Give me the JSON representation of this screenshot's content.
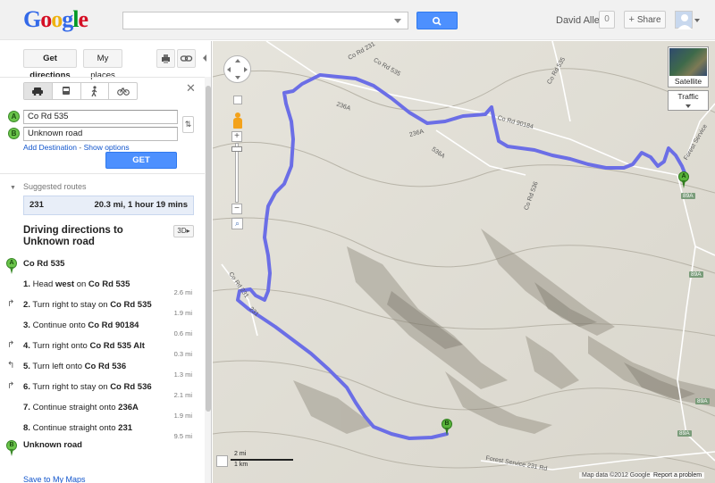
{
  "header": {
    "logo": [
      "G",
      "o",
      "o",
      "g",
      "l",
      "e"
    ],
    "user_name": "David Allen",
    "notification_count": "0",
    "share_label": "Share",
    "brand_blue": "#4d90fe"
  },
  "panel": {
    "get_directions_tab": "Get directions",
    "my_places_tab": "My places",
    "waypoint_a_letter": "A",
    "waypoint_b_letter": "B",
    "waypoint_a_value": "Co Rd 535",
    "waypoint_b_value": "Unknown road",
    "add_destination": "Add Destination",
    "show_options": "Show options",
    "get_directions_button": "GET DIRECTIONS",
    "suggested_routes_label": "Suggested routes",
    "route": {
      "name": "231",
      "summary": "20.3 mi, 1 hour 19 mins"
    },
    "directions_title": "Driving directions to Unknown road",
    "btn_3d": "3D",
    "start_name": "Co Rd 535",
    "end_name": "Unknown road",
    "steps": [
      {
        "num": "1.",
        "pre": "Head ",
        "bold1": "west",
        "mid": " on ",
        "road": "Co Rd 535",
        "dist": "2.6 mi"
      },
      {
        "num": "2.",
        "pre": "Turn right to stay on ",
        "bold1": "",
        "mid": "",
        "road": "Co Rd 535",
        "dist": "1.9 mi"
      },
      {
        "num": "3.",
        "pre": "Continue onto ",
        "bold1": "",
        "mid": "",
        "road": "Co Rd 90184",
        "dist": "0.6 mi"
      },
      {
        "num": "4.",
        "pre": "Turn right onto ",
        "bold1": "",
        "mid": "",
        "road": "Co Rd 535 Alt",
        "dist": "0.3 mi"
      },
      {
        "num": "5.",
        "pre": "Turn left onto ",
        "bold1": "",
        "mid": "",
        "road": "Co Rd 536",
        "dist": "1.3 mi"
      },
      {
        "num": "6.",
        "pre": "Turn right to stay on ",
        "bold1": "",
        "mid": "",
        "road": "Co Rd 536",
        "dist": "2.1 mi"
      },
      {
        "num": "7.",
        "pre": "Continue straight onto ",
        "bold1": "",
        "mid": "",
        "road": "236A",
        "dist": "1.9 mi"
      },
      {
        "num": "8.",
        "pre": "Continue straight onto ",
        "bold1": "",
        "mid": "",
        "road": "231",
        "dist": "9.5 mi"
      }
    ],
    "save_link": "Save to My Maps"
  },
  "map": {
    "satellite_label": "Satellite",
    "traffic_label": "Traffic",
    "pin_a": "A",
    "pin_b": "B",
    "scale_mi": "2 mi",
    "scale_km": "1 km",
    "copyright": "Map data ©2012 Google -",
    "report_problem": "Report a problem",
    "route_color": "#6b6ee6",
    "road_labels": [
      "Co Rd 231",
      "Co Rd 535",
      "Co Rd 535",
      "236A",
      "236A",
      "536A",
      "Co Rd 536",
      "Forest Service",
      "89A",
      "89A",
      "89A",
      "89A",
      "Forest Service 231 Rd",
      "Co Rd 90184",
      "231",
      "Co Rd 231"
    ]
  }
}
